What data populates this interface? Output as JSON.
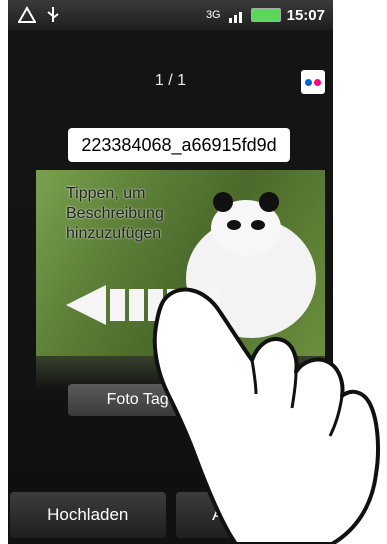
{
  "status": {
    "network": "3G",
    "time": "15:07"
  },
  "counter": "1 / 1",
  "title": "223384068_a66915fd9d",
  "photo": {
    "caption_lines": [
      "Tippen, um",
      "Beschreibung",
      "hinzuzufügen"
    ]
  },
  "tag_button": "Foto Tag hinzufügen",
  "buttons": {
    "upload": "Hochladen",
    "cancel": "Abbrechen"
  },
  "colors": {
    "flickr_blue": "#0063dc",
    "flickr_pink": "#ff0084",
    "battery_green": "#5cd65c"
  }
}
